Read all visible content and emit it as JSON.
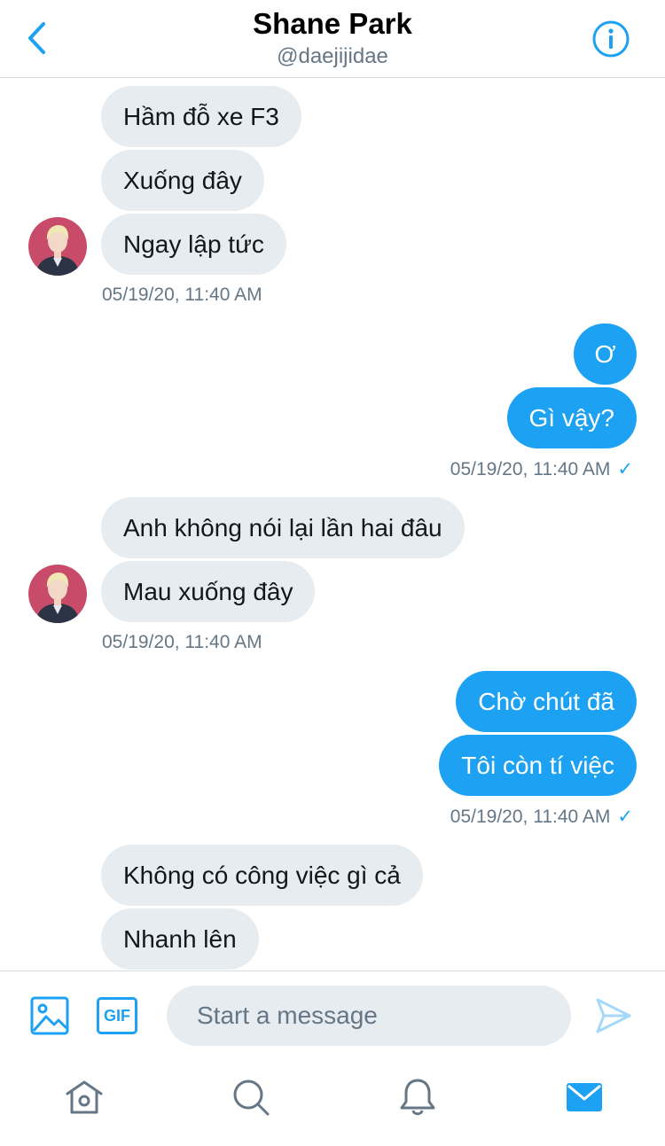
{
  "header": {
    "name": "Shane Park",
    "handle": "@daejijidae"
  },
  "messages": [
    {
      "from": "them",
      "text": "Hầm đỗ xe F3"
    },
    {
      "from": "them",
      "text": "Xuống đây"
    },
    {
      "from": "them",
      "text": "Ngay lập tức"
    },
    {
      "from": "them",
      "timestamp": "05/19/20, 11:40 AM"
    },
    {
      "from": "me",
      "text": "Ơ"
    },
    {
      "from": "me",
      "text": "Gì vậy?"
    },
    {
      "from": "me",
      "timestamp": "05/19/20, 11:40 AM",
      "read_mark": "✓"
    },
    {
      "from": "them",
      "text": "Anh không nói lại lần hai đâu"
    },
    {
      "from": "them",
      "text": "Mau xuống đây"
    },
    {
      "from": "them",
      "timestamp": "05/19/20, 11:40 AM"
    },
    {
      "from": "me",
      "text": "Chờ chút đã"
    },
    {
      "from": "me",
      "text": "Tôi còn tí việc"
    },
    {
      "from": "me",
      "timestamp": "05/19/20, 11:40 AM",
      "read_mark": "✓"
    },
    {
      "from": "them",
      "text": "Không có công việc gì cả"
    },
    {
      "from": "them",
      "text": "Nhanh lên"
    }
  ],
  "composer": {
    "placeholder": "Start a message",
    "gif_label": "GIF"
  },
  "tabs": [
    {
      "icon": "home-icon",
      "active": false
    },
    {
      "icon": "search-icon",
      "active": false
    },
    {
      "icon": "bell-icon",
      "active": false
    },
    {
      "icon": "mail-icon",
      "active": true
    }
  ],
  "colors": {
    "accent": "#1da1f2",
    "incoming_bubble": "#e6ecf0",
    "muted_text": "#657786",
    "tab_inactive": "#657786"
  }
}
